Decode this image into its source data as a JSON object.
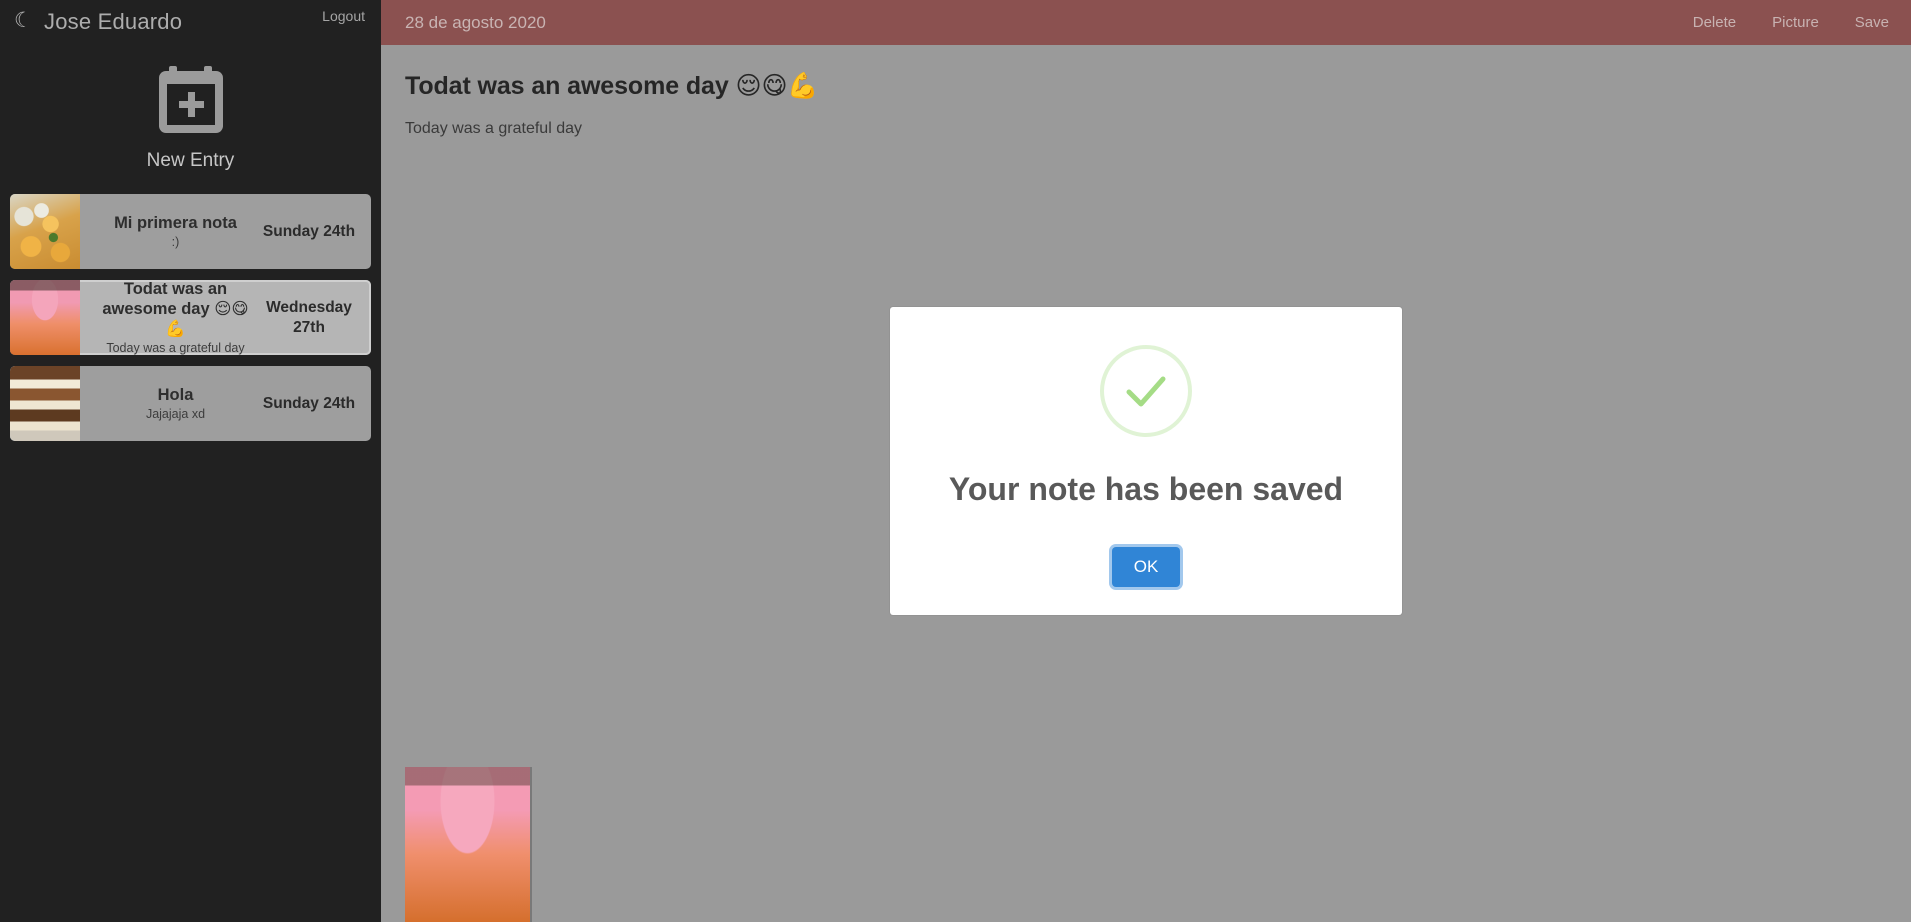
{
  "sidebar": {
    "brand": {
      "icon": "moon-icon",
      "glyph": "☾",
      "name": "Jose Eduardo"
    },
    "logout_label": "Logout",
    "new_entry": {
      "icon": "calendar-plus-icon",
      "label": "New Entry"
    },
    "entries": [
      {
        "title": "Mi primera nota",
        "snippet": ":)",
        "date": "Sunday 24th",
        "thumb": "pasta-photo",
        "selected": false
      },
      {
        "title": "Todat was an awesome day 😌😋💪",
        "snippet": "Today was a grateful day",
        "date": "Wednesday 27th",
        "thumb": "drink-photo",
        "selected": true
      },
      {
        "title": "Hola",
        "snippet": "Jajajaja xd",
        "date": "Sunday 24th",
        "thumb": "icecream-photo",
        "selected": false
      }
    ]
  },
  "topbar": {
    "date": "28 de agosto 2020",
    "delete_label": "Delete",
    "picture_label": "Picture",
    "save_label": "Save"
  },
  "note": {
    "title": "Todat was an awesome day 😌😋💪",
    "body": "Today was a grateful day",
    "attachment": "drink-photo"
  },
  "modal": {
    "icon": "success-check-icon",
    "title": "Your note has been saved",
    "ok_label": "OK"
  },
  "colors": {
    "sidebar_bg": "#212121",
    "topbar_bg": "#8b5150",
    "main_bg": "#9a9a9a",
    "accent_button": "#3085d6",
    "success_green": "#a5dc86"
  }
}
